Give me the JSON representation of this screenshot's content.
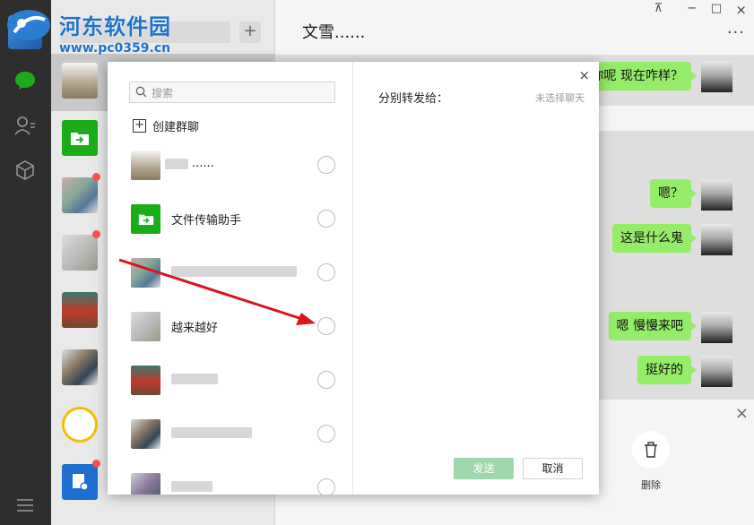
{
  "watermark": {
    "title": "河东软件园",
    "url": "www.pc0359.cn"
  },
  "chat": {
    "title": "文雪......",
    "more": "···",
    "messages": [
      {
        "text": "你呢 现在咋样？"
      },
      {
        "text": "嗯？"
      },
      {
        "text": "这是什么鬼"
      },
      {
        "text": "嗯 慢慢来吧"
      },
      {
        "text": "挺好的"
      }
    ],
    "delete_label": "删除",
    "close_bottom": "×"
  },
  "window_controls": {
    "pin": "⊼",
    "minimize": "−",
    "maximize": "□",
    "close": "×"
  },
  "chatlist": {
    "add_label": "+"
  },
  "modal": {
    "search_placeholder": "搜索",
    "create_group": "创建群聊",
    "close": "×",
    "forward_title": "分别转发给：",
    "no_selection": "未选择聊天",
    "send": "发送",
    "cancel": "取消",
    "contacts": [
      {
        "name": "......"
      },
      {
        "name": "文件传输助手"
      },
      {
        "name": ""
      },
      {
        "name": "越来越好"
      },
      {
        "name": ""
      },
      {
        "name": ""
      },
      {
        "name": ""
      }
    ]
  },
  "colors": {
    "bubble": "#95ec69",
    "send_button": "#9fd8ac",
    "unread_dot": "#fa5151",
    "sidebar": "#2e2e2e"
  }
}
